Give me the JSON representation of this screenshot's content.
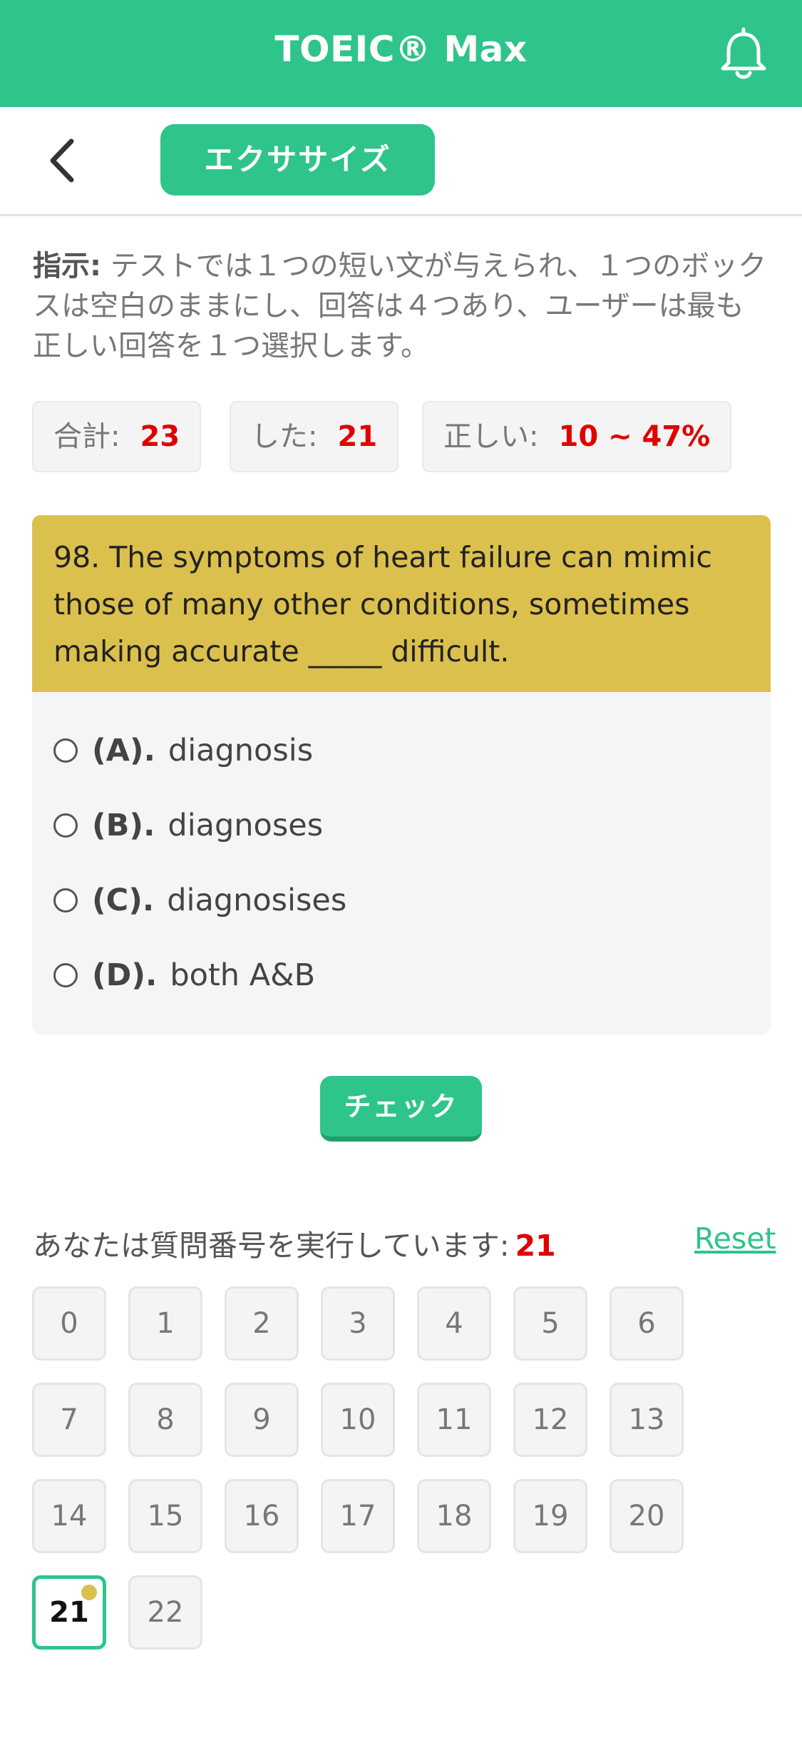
{
  "header": {
    "title": "TOEIC® Max",
    "bell_icon": "bell-icon"
  },
  "subbar": {
    "back_icon": "chevron-left-icon",
    "tab_label": "エクササイズ"
  },
  "instructions": {
    "lead": "指示:",
    "text": " テストでは１つの短い文が与えられ、１つのボックスは空白のままにし、回答は４つあり、ユーザーは最も正しい回答を１つ選択します。"
  },
  "stats": {
    "total_label": "合計:",
    "total_value": "23",
    "done_label": "した:",
    "done_value": "21",
    "correct_label": "正しい:",
    "correct_value": "10 ~ 47%"
  },
  "question": {
    "text": "98. The symptoms of heart failure can mimic those of many other conditions, sometimes making accurate _____ difficult.",
    "options": [
      {
        "letter": "(A).",
        "text": "diagnosis"
      },
      {
        "letter": "(B).",
        "text": "diagnoses"
      },
      {
        "letter": "(C).",
        "text": "diagnosises"
      },
      {
        "letter": "(D).",
        "text": "both A&B"
      }
    ]
  },
  "check_button": "チェック",
  "progress": {
    "label": "あなたは質問番号を実行しています:",
    "current": "21",
    "reset": "Reset"
  },
  "numbers": [
    "0",
    "1",
    "2",
    "3",
    "4",
    "5",
    "6",
    "7",
    "8",
    "9",
    "10",
    "11",
    "12",
    "13",
    "14",
    "15",
    "16",
    "17",
    "18",
    "19",
    "20",
    "21",
    "22"
  ],
  "colors": {
    "accent": "#2ec48a",
    "question_bg": "#dcc04e",
    "highlight_red": "#e00000"
  }
}
